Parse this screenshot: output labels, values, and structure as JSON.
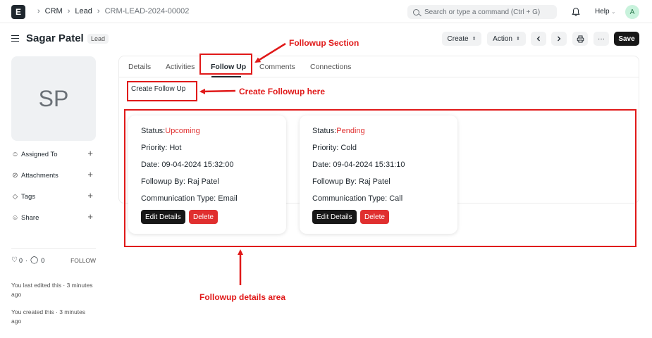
{
  "navbar": {
    "logo": "E",
    "breadcrumbs": [
      "CRM",
      "Lead",
      "CRM-LEAD-2024-00002"
    ],
    "search_placeholder": "Search or type a command (Ctrl + G)",
    "help_label": "Help",
    "user_initial": "A"
  },
  "header": {
    "title": "Sagar Patel",
    "badge": "Lead",
    "create_label": "Create",
    "action_label": "Action",
    "prev_icon": "chevron-left-icon",
    "next_icon": "chevron-right-icon",
    "print_icon": "printer-icon",
    "more_label": "···",
    "save_label": "Save"
  },
  "sidebar": {
    "avatar_initials": "SP",
    "items": [
      {
        "label": "Assigned To",
        "icon": "user-plus-icon"
      },
      {
        "label": "Attachments",
        "icon": "paperclip-icon"
      },
      {
        "label": "Tags",
        "icon": "tag-icon"
      },
      {
        "label": "Share",
        "icon": "share-icon"
      }
    ],
    "likes": "0",
    "comments": "0",
    "follow_label": "FOLLOW",
    "edited_note": "You last edited this · 3 minutes ago",
    "created_note": "You created this · 3 minutes ago"
  },
  "tabs": [
    "Details",
    "Activities",
    "Follow Up",
    "Comments",
    "Connections"
  ],
  "active_tab": "Follow Up",
  "create_followup_label": "Create Follow Up",
  "followups": [
    {
      "status_label": "Status:",
      "status_value": "Upcoming",
      "priority": "Priority: Hot",
      "date": "Date: 09-04-2024 15:32:00",
      "followup_by": "Followup By: Raj Patel",
      "communication": "Communication Type: Email",
      "edit_label": "Edit Details",
      "delete_label": "Delete"
    },
    {
      "status_label": "Status:",
      "status_value": "Pending",
      "priority": "Priority: Cold",
      "date": "Date: 09-04-2024 15:31:10",
      "followup_by": "Followup By: Raj Patel",
      "communication": "Communication Type: Call",
      "edit_label": "Edit Details",
      "delete_label": "Delete"
    }
  ],
  "annotations": {
    "followup_section": "Followup Section",
    "create_followup_here": "Create Followup here",
    "followup_details_area": "Followup details area"
  },
  "colors": {
    "annotation_red": "#e01919",
    "status_red": "#e02f2f",
    "primary_dark": "#171717",
    "delete_red": "#e02f2f"
  }
}
